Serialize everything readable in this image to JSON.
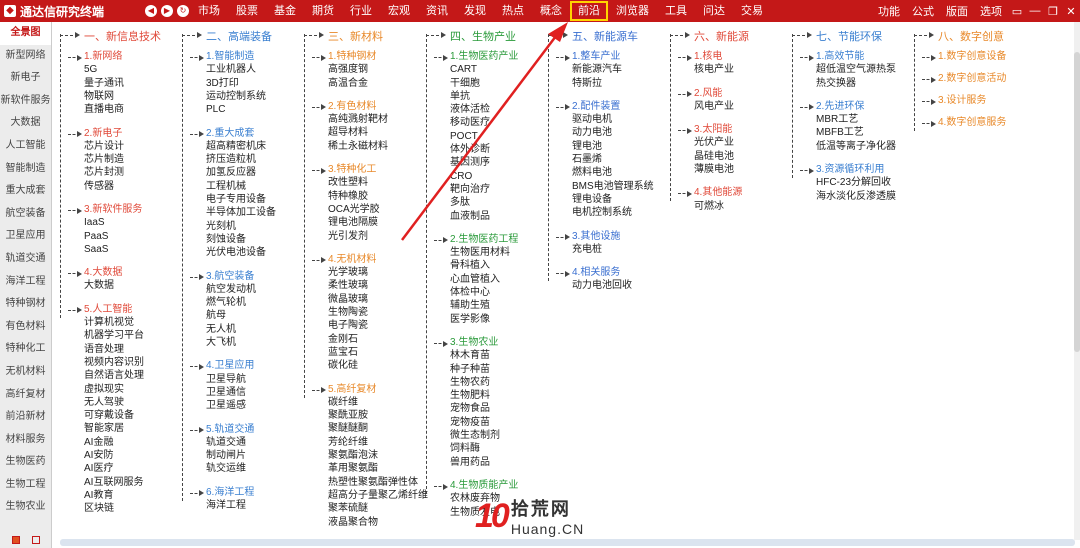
{
  "app": {
    "title": "通达信研究终端",
    "logo_icon": "logo-icon"
  },
  "menu": [
    "市场",
    "股票",
    "基金",
    "期货",
    "行业",
    "宏观",
    "资讯",
    "发现",
    "热点",
    "概念",
    "前沿",
    "浏览器",
    "工具",
    "问达",
    "交易"
  ],
  "menu_active_index": 10,
  "right_menu": [
    "功能",
    "公式",
    "版面",
    "选项"
  ],
  "window_buttons": [
    "▭",
    "—",
    "❐",
    "✕"
  ],
  "sidebar": [
    "全景图",
    "新型网络",
    "新电子",
    "新软件服务",
    "大数据",
    "人工智能",
    "智能制造",
    "重大成套",
    "航空装备",
    "卫星应用",
    "轨道交通",
    "海洋工程",
    "特种钢材",
    "有色材料",
    "特种化工",
    "无机材料",
    "高纤复材",
    "前沿新材",
    "材料服务",
    "生物医药",
    "生物工程",
    "生物农业"
  ],
  "sidebar_selected": 0,
  "columns": [
    {
      "head": "一、新信息技术",
      "groups": [
        {
          "title": "1.新网络",
          "items": [
            "5G",
            "量子通讯",
            "物联网",
            "直播电商"
          ]
        },
        {
          "title": "2.新电子",
          "items": [
            "芯片设计",
            "芯片制造",
            "芯片封测",
            "传感器"
          ]
        },
        {
          "title": "3.新软件服务",
          "items": [
            "IaaS",
            "PaaS",
            "SaaS"
          ]
        },
        {
          "title": "4.大数据",
          "items": [
            "大数据"
          ]
        },
        {
          "title": "5.人工智能",
          "items": [
            "计算机视觉",
            "机器学习平台",
            "语音处理",
            "视频内容识别",
            "自然语言处理",
            "虚拟现实",
            "无人驾驶",
            "可穿戴设备",
            "智能家居",
            "AI金融",
            "AI安防",
            "AI医疗",
            "AI互联网服务",
            "AI教育",
            "区块链"
          ]
        }
      ]
    },
    {
      "head": "二、高端装备",
      "groups": [
        {
          "title": "1.智能制造",
          "items": [
            "工业机器人",
            "3D打印",
            "运动控制系统",
            "PLC"
          ]
        },
        {
          "title": "2.重大成套",
          "items": [
            "超高精密机床",
            "挤压造粒机",
            "加氢反应器",
            "工程机械",
            "电子专用设备",
            "半导体加工设备",
            "光刻机",
            "刻蚀设备",
            "光伏电池设备"
          ]
        },
        {
          "title": "3.航空装备",
          "items": [
            "航空发动机",
            "燃气轮机",
            "航母",
            "无人机",
            "大飞机"
          ]
        },
        {
          "title": "4.卫星应用",
          "items": [
            "卫星导航",
            "卫星通信",
            "卫星遥感"
          ]
        },
        {
          "title": "5.轨道交通",
          "items": [
            "轨道交通",
            "制动闸片",
            "轨交运维"
          ]
        },
        {
          "title": "6.海洋工程",
          "items": [
            "海洋工程"
          ]
        }
      ]
    },
    {
      "head": "三、新材料",
      "groups": [
        {
          "title": "1.特种钢材",
          "items": [
            "高强度钢",
            "高温合金"
          ]
        },
        {
          "title": "2.有色材料",
          "items": [
            "高纯溅射靶材",
            "超导材料",
            "稀土永磁材料"
          ]
        },
        {
          "title": "3.特种化工",
          "items": [
            "改性塑料",
            "特种橡胶",
            "OCA光学胶",
            "锂电池隔膜",
            "光引发剂"
          ]
        },
        {
          "title": "4.无机材料",
          "items": [
            "光学玻璃",
            "柔性玻璃",
            "微晶玻璃",
            "生物陶瓷",
            "电子陶瓷",
            "金刚石",
            "蓝宝石",
            "碳化硅"
          ]
        },
        {
          "title": "5.高纤复材",
          "items": [
            "碳纤维",
            "聚酰亚胺",
            "聚醚醚酮",
            "芳纶纤维",
            "聚氨酯泡沫",
            "革用聚氨酯",
            "热塑性聚氨酯弹性体",
            "超高分子量聚乙烯纤维",
            "聚苯硫醚",
            "液晶聚合物"
          ]
        }
      ]
    },
    {
      "head": "四、生物产业",
      "groups": [
        {
          "title": "1.生物医药产业",
          "items": [
            "CART",
            "干细胞",
            "单抗",
            "液体活检",
            "移动医疗",
            "POCT",
            "体外诊断",
            "基因测序",
            "CRO",
            "靶向治疗",
            "多肽",
            "血液制品"
          ]
        },
        {
          "title": "2.生物医药工程",
          "items": [
            "生物医用材料",
            "骨科植入",
            "心血管植入",
            "体检中心",
            "辅助生殖",
            "医学影像"
          ]
        },
        {
          "title": "3.生物农业",
          "items": [
            "林木育苗",
            "种子种苗",
            "生物农药",
            "生物肥料",
            "宠物食品",
            "宠物疫苗",
            "微生态制剂",
            "饲料酶",
            "兽用药品"
          ]
        },
        {
          "title": "4.生物质能产业",
          "items": [
            "农林废弃物",
            "生物质发电"
          ]
        }
      ]
    },
    {
      "head": "五、新能源车",
      "groups": [
        {
          "title": "1.整车产业",
          "items": [
            "新能源汽车",
            "特斯拉"
          ]
        },
        {
          "title": "2.配件装置",
          "items": [
            "驱动电机",
            "动力电池",
            "锂电池",
            "石墨烯",
            "燃料电池",
            "BMS电池管理系统",
            "锂电设备",
            "电机控制系统"
          ]
        },
        {
          "title": "3.其他设施",
          "items": [
            "充电桩"
          ]
        },
        {
          "title": "4.相关服务",
          "items": [
            "动力电池回收"
          ]
        }
      ]
    },
    {
      "head": "六、新能源",
      "groups": [
        {
          "title": "1.核电",
          "items": [
            "核电产业"
          ]
        },
        {
          "title": "2.风能",
          "items": [
            "风电产业"
          ]
        },
        {
          "title": "3.太阳能",
          "items": [
            "光伏产业",
            "晶硅电池",
            "薄膜电池"
          ]
        },
        {
          "title": "4.其他能源",
          "items": [
            "可燃冰"
          ]
        }
      ]
    },
    {
      "head": "七、节能环保",
      "groups": [
        {
          "title": "1.高效节能",
          "items": [
            "超低温空气源热泵",
            "热交换器"
          ]
        },
        {
          "title": "2.先进环保",
          "items": [
            "MBR工艺",
            "MBFB工艺",
            "低温等离子净化器"
          ]
        },
        {
          "title": "3.资源循环利用",
          "items": [
            "HFC-23分解回收",
            "海水淡化反渗透膜"
          ]
        }
      ]
    },
    {
      "head": "八、数字创意",
      "groups": [
        {
          "title": "1.数字创意设备",
          "items": []
        },
        {
          "title": "2.数字创意活动",
          "items": []
        },
        {
          "title": "3.设计服务",
          "items": []
        },
        {
          "title": "4.数字创意服务",
          "items": []
        }
      ]
    }
  ],
  "colors": {
    "bar": "#c41818",
    "highlight": "#ffd400",
    "c1": "#e04a3a",
    "c2": "#3a7fd0",
    "c3": "#e8892a",
    "c4": "#2a9a3a",
    "c5": "#3a6fd0",
    "c6": "#e04a3a",
    "c7": "#3a7fd0",
    "c8": "#e8892a"
  },
  "watermark": {
    "ten": "10",
    "cn": "拾荒网",
    "en": "Huang.CN"
  }
}
